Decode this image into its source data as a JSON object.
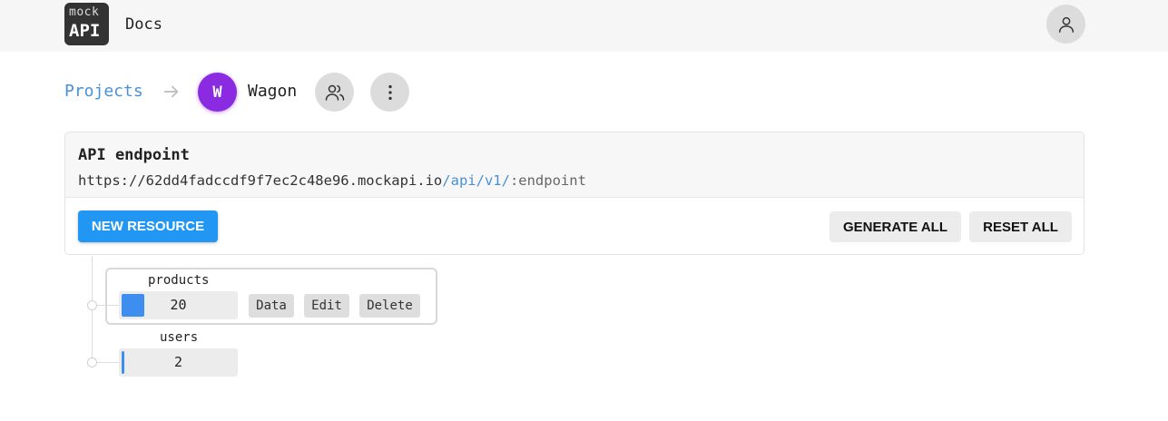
{
  "header": {
    "logo_top": "mock",
    "logo_bottom": "API",
    "docs_link": "Docs"
  },
  "breadcrumb": {
    "projects_label": "Projects",
    "project_initial": "W",
    "project_name": "Wagon"
  },
  "endpoint_card": {
    "title": "API endpoint",
    "url_base": "https://62dd4fadccdf9f7ec2c48e96.mockapi.io",
    "url_path": "/api/v1/",
    "url_endpoint": ":endpoint",
    "new_resource_label": "NEW RESOURCE",
    "generate_all_label": "GENERATE ALL",
    "reset_all_label": "RESET ALL"
  },
  "resources": [
    {
      "name": "products",
      "count": "20",
      "fill_fraction": 0.2
    },
    {
      "name": "users",
      "count": "2",
      "fill_fraction": 0.02
    }
  ],
  "resource_actions": {
    "data_label": "Data",
    "edit_label": "Edit",
    "delete_label": "Delete"
  },
  "colors": {
    "accent": "#2196f3",
    "link": "#4a90d9",
    "avatar": "#8a2be2",
    "count_fill": "#3e8ef0"
  },
  "icons": {
    "user": "user-icon",
    "arrow": "arrow-right-icon",
    "members": "users-icon",
    "menu": "more-vertical-icon"
  }
}
